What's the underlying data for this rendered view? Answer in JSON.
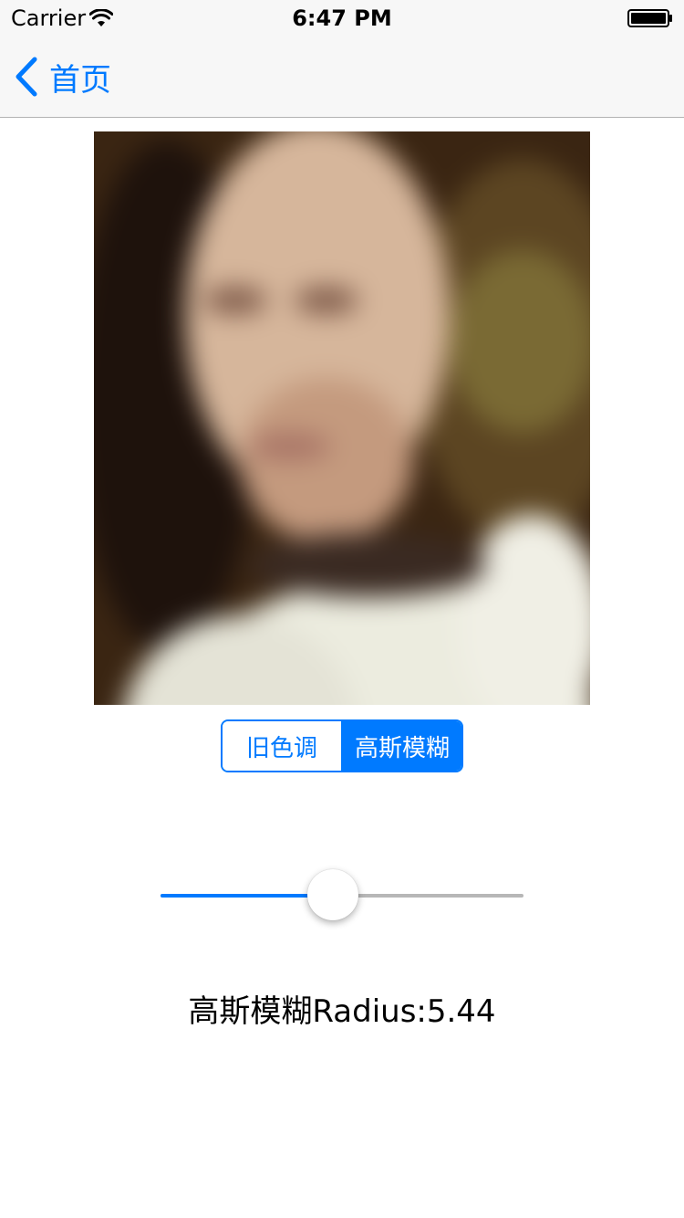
{
  "status_bar": {
    "carrier": "Carrier",
    "time": "6:47 PM",
    "wifi_icon": "wifi-icon",
    "battery_icon": "battery-icon"
  },
  "nav": {
    "back_label": "首页",
    "back_icon": "chevron-left-icon"
  },
  "photo": {
    "description_icon": "blurred-photo"
  },
  "segmented": {
    "options": [
      "旧色调",
      "高斯模糊"
    ],
    "selected_index": 1
  },
  "slider": {
    "value_fraction": 0.47
  },
  "radius_text": "高斯模糊Radius:5.44",
  "colors": {
    "accent": "#007aff",
    "track": "#b7b7b7",
    "bar_bg": "#f7f7f7"
  }
}
